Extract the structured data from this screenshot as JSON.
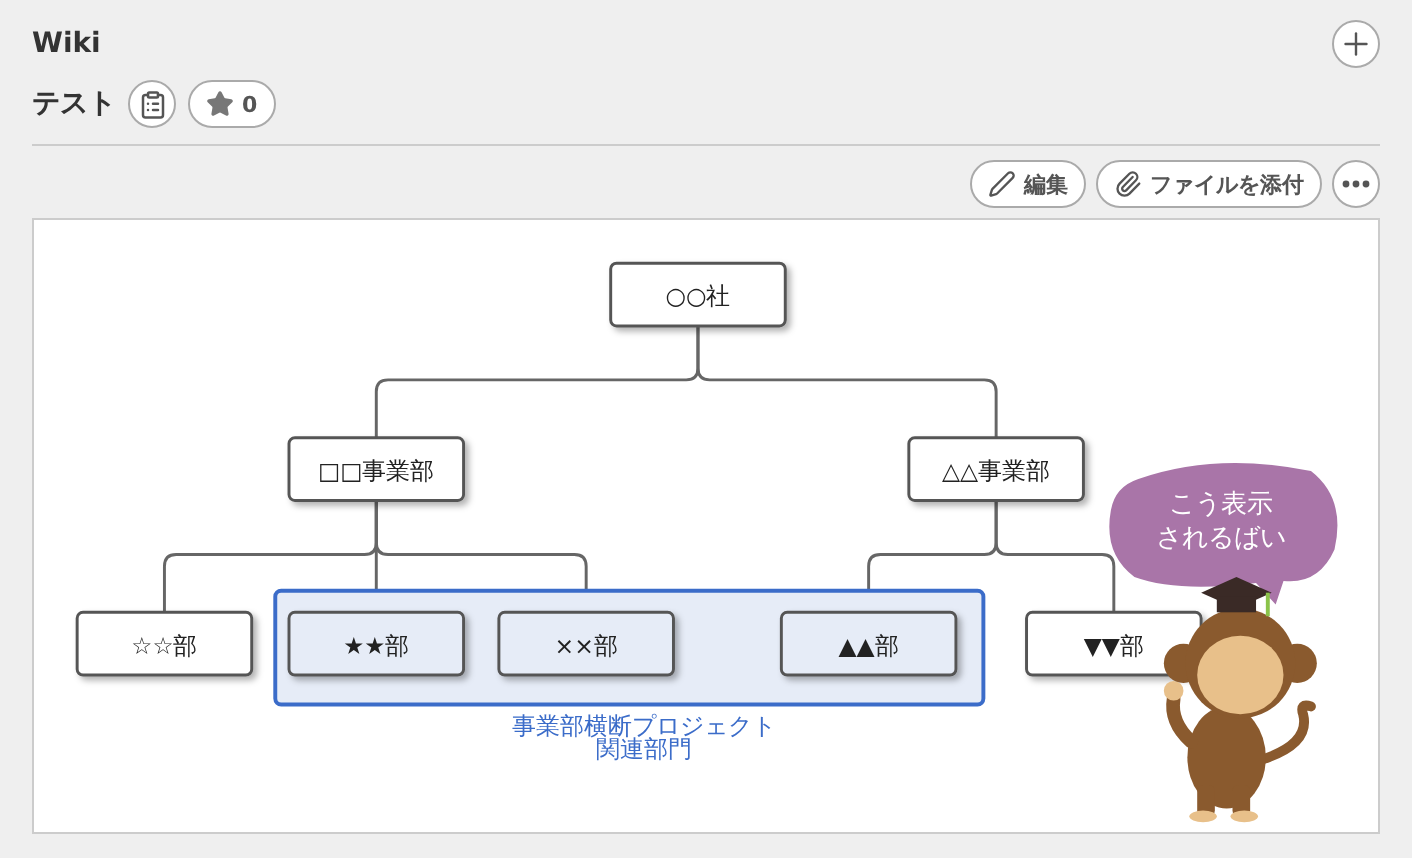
{
  "header": {
    "title": "Wiki"
  },
  "page": {
    "title": "テスト",
    "star_count": "0"
  },
  "toolbar": [
    {
      "kind": "edit",
      "label": "編集"
    },
    {
      "kind": "attach",
      "label": "ファイルを添付"
    },
    {
      "kind": "more"
    }
  ],
  "diagram": {
    "nodes": [
      {
        "label": "○○社",
        "in_group": false,
        "children": [
          {
            "label": "□□事業部",
            "in_group": false,
            "children": [
              {
                "label": "☆☆部",
                "in_group": false
              },
              {
                "label": "★★部",
                "in_group": true
              },
              {
                "label": "××部",
                "in_group": true
              }
            ]
          },
          {
            "label": "△△事業部",
            "in_group": false,
            "children": [
              {
                "label": "▲▲部",
                "in_group": true
              },
              {
                "label": "▼▼部",
                "in_group": false
              }
            ]
          }
        ]
      }
    ],
    "group_label": [
      "事業部横断プロジェクト",
      "関連部門"
    ],
    "speech_bubble": [
      "こう表示",
      "されるばい"
    ]
  }
}
